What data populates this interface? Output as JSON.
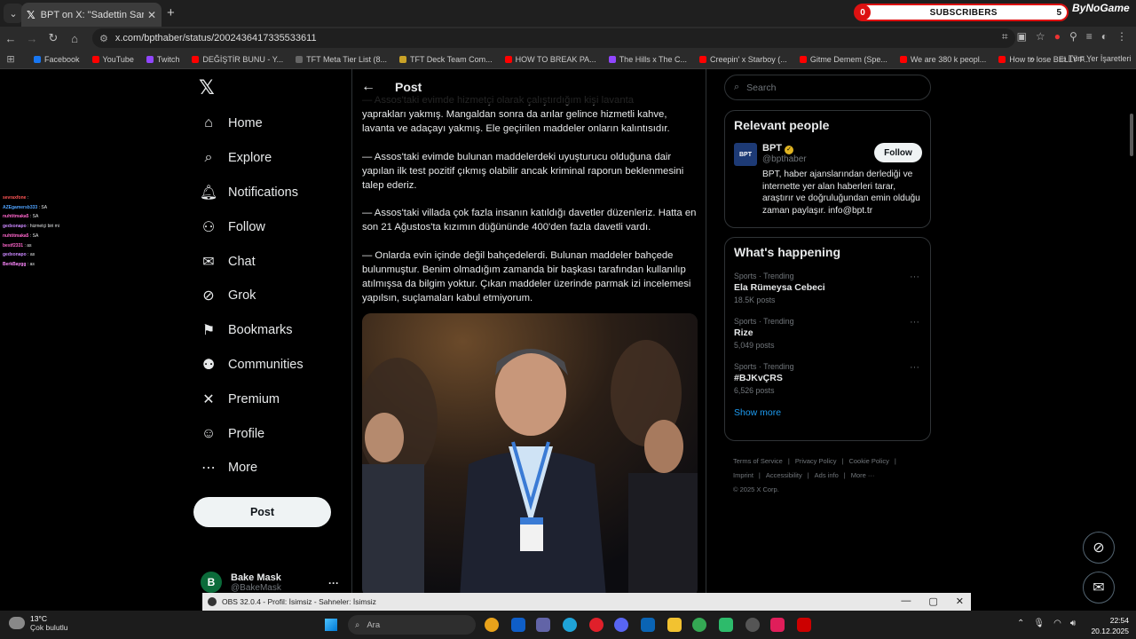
{
  "browser": {
    "tab_title": "BPT on X: \"Sadettin Saran'ın ifa",
    "url": "x.com/bpthaber/status/2002436417335533611",
    "bookmarks": [
      {
        "label": "Facebook",
        "color": "#1877f2"
      },
      {
        "label": "YouTube",
        "color": "#ff0000"
      },
      {
        "label": "Twitch",
        "color": "#9146ff"
      },
      {
        "label": "DEĞİŞTİR BUNU - Y...",
        "color": "#ff0000"
      },
      {
        "label": "TFT Meta Tier List (8...",
        "color": "#666666"
      },
      {
        "label": "TFT Deck Team Com...",
        "color": "#c9a227"
      },
      {
        "label": "HOW TO BREAK PA...",
        "color": "#ff0000"
      },
      {
        "label": "The Hills x The C...",
        "color": "#9146ff"
      },
      {
        "label": "Creepin' x Starboy (...",
        "color": "#ff0000"
      },
      {
        "label": "Gitme Demem (Spe...",
        "color": "#ff0000"
      },
      {
        "label": "We are 380 k peopl...",
        "color": "#ff0000"
      },
      {
        "label": "How to lose BELLY F...",
        "color": "#ff0000"
      }
    ],
    "all_bookmarks": "Tüm Yer İşaretleri"
  },
  "overlay": {
    "subs_count_left": "0",
    "subs_label": "SUBSCRIBERS",
    "subs_count_right": "5",
    "brand": "ByNoGame",
    "chat": [
      {
        "user": "sevraxfone",
        "msg": "",
        "color": "#ff5555"
      },
      {
        "user": "AZEgamersb333",
        "msg": "SA",
        "color": "#4fa3ff"
      },
      {
        "user": "nuhtitmaka5",
        "msg": "SA",
        "color": "#ff66cc"
      },
      {
        "user": "gedxonapo",
        "msg": "hizmetçi biri mi",
        "color": "#cc88ff"
      },
      {
        "user": "nuhtitmaka5",
        "msg": "SA",
        "color": "#ff66cc"
      },
      {
        "user": "bestf2331",
        "msg": "as",
        "color": "#ff66cc"
      },
      {
        "user": "gedxonapo",
        "msg": "as",
        "color": "#cc88ff"
      },
      {
        "user": "BerkBaygg",
        "msg": "as",
        "color": "#ff88ff"
      }
    ]
  },
  "nav": {
    "items": [
      {
        "label": "Home",
        "icon": "⌂",
        "icon_name": "home-icon"
      },
      {
        "label": "Explore",
        "icon": "⌕",
        "icon_name": "search-icon"
      },
      {
        "label": "Notifications",
        "icon": "🔔︎",
        "icon_name": "bell-icon"
      },
      {
        "label": "Follow",
        "icon": "⚇",
        "icon_name": "add-person-icon"
      },
      {
        "label": "Chat",
        "icon": "✉",
        "icon_name": "mail-icon"
      },
      {
        "label": "Grok",
        "icon": "⊘",
        "icon_name": "grok-icon"
      },
      {
        "label": "Bookmarks",
        "icon": "⚑",
        "icon_name": "bookmark-icon"
      },
      {
        "label": "Communities",
        "icon": "⚉",
        "icon_name": "communities-icon"
      },
      {
        "label": "Premium",
        "icon": "✕",
        "icon_name": "x-premium-icon"
      },
      {
        "label": "Profile",
        "icon": "☺",
        "icon_name": "profile-icon"
      },
      {
        "label": "More",
        "icon": "⋯",
        "icon_name": "more-circle-icon"
      }
    ],
    "post_button": "Post",
    "account_name": "Bake Mask",
    "account_handle": "@BakeMask",
    "avatar_letter": "B"
  },
  "post": {
    "header_title": "Post",
    "cut_line": "— Assos'taki evimde hizmetçi olarak çalıştırdığım kişi lavanta",
    "paragraphs": [
      "yaprakları yakmış. Mangaldan sonra da arılar gelince hizmetli kahve, lavanta ve adaçayı yakmış. Ele geçirilen maddeler onların kalıntısıdır.",
      "— Assos'taki evimde bulunan maddelerdeki uyuşturucu olduğuna dair yapılan ilk test pozitif çıkmış olabilir ancak kriminal raporun beklenmesini talep ederiz.",
      "— Assos'taki villada çok fazla insanın katıldığı davetler düzenleriz. Hatta en son 21 Ağustos'ta kızımın düğününde 400'den fazla davetli vardı.",
      "— Onlarda evin içinde değil bahçedelerdi. Bulunan maddeler bahçede bulunmuştur. Benim olmadığım zamanda bir başkası tarafından kullanılıp atılmışsa da bilgim yoktur. Çıkan maddeler üzerinde parmak izi incelemesi yapılsın, suçlamaları kabul etmiyorum."
    ]
  },
  "sidebar": {
    "search_placeholder": "Search",
    "relevant_title": "Relevant people",
    "person": {
      "logo_text": "BPT",
      "name": "BPT",
      "handle": "@bpthaber",
      "follow_label": "Follow",
      "bio": "BPT, haber ajanslarından derlediği ve internette yer alan haberleri tarar, araştırır ve doğruluğundan emin olduğu zaman paylaşır. info@bpt.tr"
    },
    "happening_title": "What's happening",
    "trends": [
      {
        "meta": "Sports · Trending",
        "name": "Ela Rümeysa Cebeci",
        "posts": "18.5K posts"
      },
      {
        "meta": "Sports · Trending",
        "name": "Rize",
        "posts": "5,049 posts"
      },
      {
        "meta": "Sports · Trending",
        "name": "#BJKvÇRS",
        "posts": "6,526 posts"
      }
    ],
    "show_more": "Show more",
    "footer": [
      "Terms of Service",
      "|",
      "Privacy Policy",
      "|",
      "Cookie Policy",
      "|",
      "Imprint",
      "|",
      "Accessibility",
      "|",
      "Ads info",
      "|",
      "More ···",
      "© 2025 X Corp."
    ]
  },
  "obs": {
    "title": "OBS 32.0.4 - Profil: İsimsiz - Sahneler: İsimsiz"
  },
  "taskbar": {
    "temp": "13°C",
    "weather": "Çok bulutlu",
    "search_placeholder": "Ara",
    "time": "22:54",
    "date": "20.12.2025"
  },
  "colors": {
    "bg": "#000000",
    "text": "#e7e9ea",
    "muted": "#71767b",
    "accent": "#1d9bf0",
    "border": "#2f3336"
  }
}
